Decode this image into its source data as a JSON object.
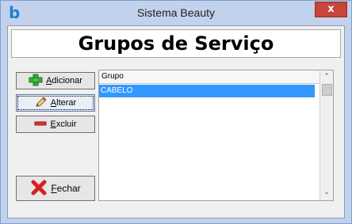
{
  "window": {
    "app_icon_glyph": "b",
    "title": "Sistema Beauty",
    "close_glyph": "x"
  },
  "header": {
    "title": "Grupos de Serviço"
  },
  "buttons": {
    "add": {
      "mnemonic": "A",
      "rest": "dicionar",
      "icon": "plus-icon"
    },
    "edit": {
      "mnemonic": "A",
      "rest": "lterar",
      "icon": "pencil-icon"
    },
    "delete": {
      "mnemonic": "E",
      "rest": "xcluir",
      "icon": "minus-icon"
    },
    "close": {
      "mnemonic": "F",
      "rest": "echar",
      "icon": "x-icon"
    }
  },
  "grid": {
    "columns": [
      "Grupo"
    ],
    "rows": [
      {
        "grupo": "CABELO",
        "selected": true
      }
    ]
  },
  "scrollbar": {
    "up_glyph": "⌃",
    "down_glyph": "⌄"
  },
  "colors": {
    "selection": "#3399ff",
    "close_button": "#c7453a",
    "app_icon": "#1e7fd6"
  }
}
